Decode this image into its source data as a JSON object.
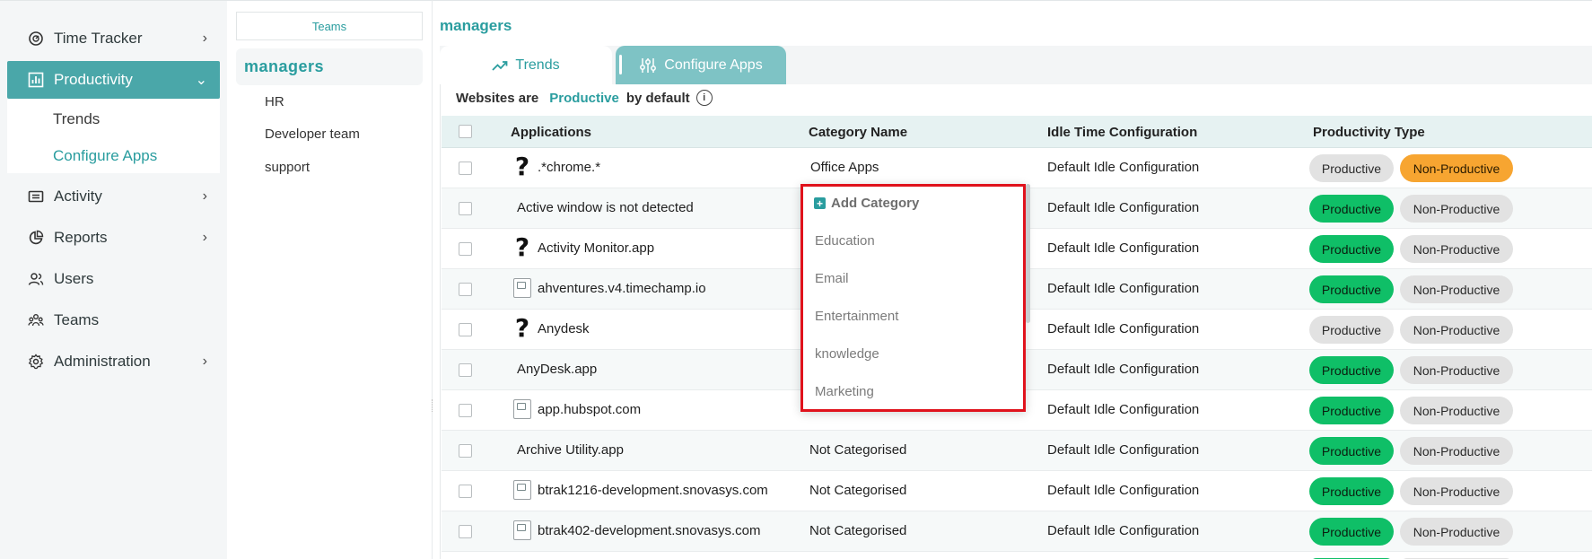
{
  "sidebar": {
    "items": [
      {
        "label": "Time Tracker",
        "icon": "stopwatch-icon"
      },
      {
        "label": "Productivity",
        "icon": "bar-chart-icon"
      },
      {
        "label": "Activity",
        "icon": "ticket-icon"
      },
      {
        "label": "Reports",
        "icon": "pie-chart-icon"
      },
      {
        "label": "Users",
        "icon": "users-icon"
      },
      {
        "label": "Teams",
        "icon": "team-icon"
      },
      {
        "label": "Administration",
        "icon": "gear-icon"
      }
    ],
    "productivity_sub": [
      "Trends",
      "Configure Apps"
    ]
  },
  "teams_panel": {
    "tab_label": "Teams",
    "selected_team": "managers",
    "teams": [
      "HR",
      "Developer team",
      "support"
    ]
  },
  "main": {
    "title": "managers",
    "tabs": [
      "Trends",
      "Configure Apps"
    ],
    "default_text": {
      "prefix": "Websites are",
      "value": "Productive",
      "suffix": "by default"
    },
    "columns": [
      "Applications",
      "Category Name",
      "Idle Time Configuration",
      "Productivity Type"
    ],
    "rows": [
      {
        "app": ".*chrome.*",
        "category": "Office Apps",
        "idle": "Default Idle Configuration",
        "prod_label": "Productive",
        "non_label": "Non-Productive"
      },
      {
        "app": "Active window is not detected",
        "category": "",
        "idle": "Default Idle Configuration",
        "prod_label": "Productive",
        "non_label": "Non-Productive"
      },
      {
        "app": "Activity Monitor.app",
        "category": "",
        "idle": "Default Idle Configuration",
        "prod_label": "Productive",
        "non_label": "Non-Productive"
      },
      {
        "app": "ahventures.v4.timechamp.io",
        "category": "",
        "idle": "Default Idle Configuration",
        "prod_label": "Productive",
        "non_label": "Non-Productive"
      },
      {
        "app": "Anydesk",
        "category": "",
        "idle": "Default Idle Configuration",
        "prod_label": "Productive",
        "non_label": "Non-Productive"
      },
      {
        "app": "AnyDesk.app",
        "category": "",
        "idle": "Default Idle Configuration",
        "prod_label": "Productive",
        "non_label": "Non-Productive"
      },
      {
        "app": "app.hubspot.com",
        "category": "",
        "idle": "Default Idle Configuration",
        "prod_label": "Productive",
        "non_label": "Non-Productive"
      },
      {
        "app": "Archive Utility.app",
        "category": "Not Categorised",
        "idle": "Default Idle Configuration",
        "prod_label": "Productive",
        "non_label": "Non-Productive"
      },
      {
        "app": "btrak1216-development.snovasys.com",
        "category": "Not Categorised",
        "idle": "Default Idle Configuration",
        "prod_label": "Productive",
        "non_label": "Non-Productive"
      },
      {
        "app": "btrak402-development.snovasys.com",
        "category": "Not Categorised",
        "idle": "Default Idle Configuration",
        "prod_label": "Productive",
        "non_label": "Non-Productive"
      }
    ]
  },
  "category_dropdown": {
    "add_label": "Add Category",
    "options": [
      "Education",
      "Email",
      "Entertainment",
      "knowledge",
      "Marketing"
    ]
  },
  "colors": {
    "accent": "#2a9d9f",
    "productive": "#0fbf67",
    "non_productive_active": "#f7a531",
    "inactive_pill": "#e2e2e2"
  }
}
